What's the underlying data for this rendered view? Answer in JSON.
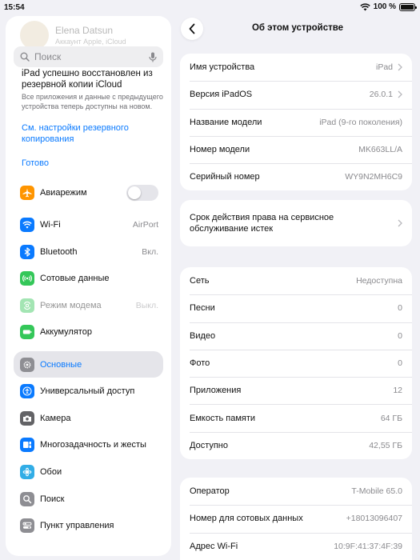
{
  "status": {
    "time": "15:54",
    "battery": "100 %"
  },
  "sidebar": {
    "profile_name": "Elena Datsun",
    "profile_sub": "Аккаунт Apple, iCloud",
    "search_placeholder": "Поиск",
    "restore": {
      "title": "iPad успешно восстановлен из резервной копии iCloud",
      "text": "Все приложения и данные с предыдущего устройства теперь доступны на новом.",
      "link": "См. настройки резервного копирования",
      "done": "Готово"
    },
    "items": [
      {
        "label": "Авиарежим",
        "icon": "airplane-icon",
        "color": "#ff9500"
      },
      {
        "label": "Wi-Fi",
        "value": "AirPort",
        "icon": "wifi-icon",
        "color": "#0a7aff"
      },
      {
        "label": "Bluetooth",
        "value": "Вкл.",
        "icon": "bluetooth-icon",
        "color": "#0a7aff"
      },
      {
        "label": "Сотовые данные",
        "icon": "cellular-icon",
        "color": "#34c759"
      },
      {
        "label": "Режим модема",
        "value": "Выкл.",
        "icon": "hotspot-icon",
        "color": "#34c759"
      },
      {
        "label": "Аккумулятор",
        "icon": "battery-icon",
        "color": "#34c759"
      },
      {
        "label": "Основные",
        "icon": "gear-icon",
        "color": "#8e8e93"
      },
      {
        "label": "Универсальный доступ",
        "icon": "accessibility-icon",
        "color": "#0a7aff"
      },
      {
        "label": "Камера",
        "icon": "camera-icon",
        "color": "#636366"
      },
      {
        "label": "Многозадачность и жесты",
        "icon": "multitasking-icon",
        "color": "#0a7aff"
      },
      {
        "label": "Обои",
        "icon": "wallpaper-icon",
        "color": "#32ade6"
      },
      {
        "label": "Поиск",
        "icon": "search-icon",
        "color": "#8e8e93"
      },
      {
        "label": "Пункт управления",
        "icon": "control-center-icon",
        "color": "#8e8e93"
      }
    ]
  },
  "detail": {
    "title": "Об этом устройстве",
    "group1": [
      {
        "label": "Имя устройства",
        "value": "iPad"
      },
      {
        "label": "Версия iPadOS",
        "value": "26.0.1"
      },
      {
        "label": "Название модели",
        "value": "iPad (9-го поколения)"
      },
      {
        "label": "Номер модели",
        "value": "MK663LL/A"
      },
      {
        "label": "Серийный номер",
        "value": "WY9N2MH6C9"
      }
    ],
    "service": {
      "label": "Срок действия права на сервисное обслуживание истек"
    },
    "group2": [
      {
        "label": "Сеть",
        "value": "Недоступна"
      },
      {
        "label": "Песни",
        "value": "0"
      },
      {
        "label": "Видео",
        "value": "0"
      },
      {
        "label": "Фото",
        "value": "0"
      },
      {
        "label": "Приложения",
        "value": "12"
      },
      {
        "label": "Емкость памяти",
        "value": "64 ГБ"
      },
      {
        "label": "Доступно",
        "value": "42,55 ГБ"
      }
    ],
    "group3": [
      {
        "label": "Оператор",
        "value": "T-Mobile 65.0"
      },
      {
        "label": "Номер для сотовых данных",
        "value": "+18013096407"
      },
      {
        "label": "Адрес Wi-Fi",
        "value": "10:9F:41:37:4F:39"
      }
    ]
  }
}
